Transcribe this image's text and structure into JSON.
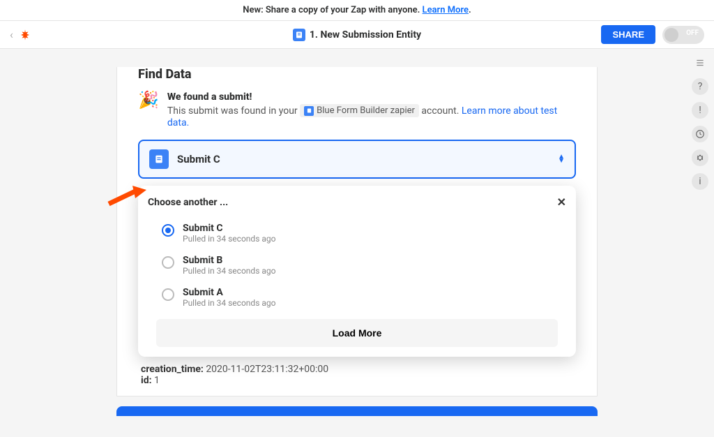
{
  "banner": {
    "text": "New: Share a copy of your Zap with anyone. ",
    "link": "Learn More",
    "period": "."
  },
  "header": {
    "title": "1. New Submission Entity",
    "share_label": "SHARE",
    "toggle_off": "OFF"
  },
  "card": {
    "heading": "Find Data",
    "found_title": "We found a submit!",
    "found_pre": "This submit was found in your ",
    "chip_label": "Blue Form Builder zapier",
    "found_post": " account. ",
    "test_link": "Learn more about test data.",
    "select_label": "Submit C"
  },
  "dropdown": {
    "head": "Choose another ...",
    "load_more": "Load More",
    "options": [
      {
        "label": "Submit C",
        "sub": "Pulled in 34 seconds ago",
        "selected": true
      },
      {
        "label": "Submit B",
        "sub": "Pulled in 34 seconds ago",
        "selected": false
      },
      {
        "label": "Submit A",
        "sub": "Pulled in 34 seconds ago",
        "selected": false
      }
    ]
  },
  "preview": {
    "line1_key": "creation_time:",
    "line1_val": " 2020-11-02T23:11:32+00:00",
    "line2_key": "id:",
    "line2_val": " 1"
  }
}
